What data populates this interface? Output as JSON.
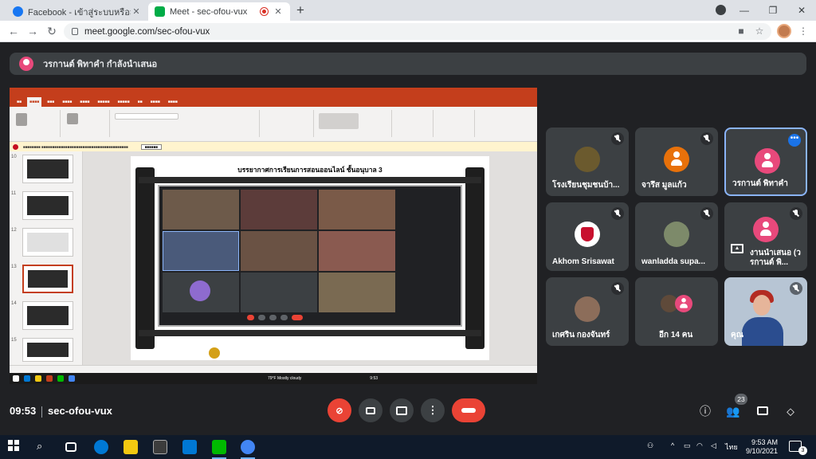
{
  "browser": {
    "tabs": [
      {
        "title": "Facebook - เข้าสู่ระบบหรือสมัครใช้งาน",
        "favicon_color": "#1877f2"
      },
      {
        "title": "Meet - sec-ofou-vux",
        "favicon_color": "#00ac47"
      }
    ],
    "url": "meet.google.com/sec-ofou-vux"
  },
  "banner": {
    "text": "วรกานต์ พิทาคำ กำลังนำเสนอ"
  },
  "presentation": {
    "slide_title": "บรรยากาศการเรียนการสอนออนไลน์ ชั้นอนุบาล 3",
    "thumb_numbers": [
      "10",
      "11",
      "12",
      "13",
      "14",
      "15"
    ],
    "taskbar_weather": "79°F  Mostly cloudy",
    "taskbar_time": "9:53"
  },
  "participants": [
    {
      "name": "โรงเรียนชุมชนบ้า...",
      "type": "photo",
      "color": "#6b5a2e"
    },
    {
      "name": "จารึส มูลแก้ว",
      "type": "avatar",
      "color": "#e8710a"
    },
    {
      "name": "วรกานต์ พิทาคำ",
      "type": "avatar",
      "color": "#e8497b"
    },
    {
      "name": "Akhom Srisawat",
      "type": "logo",
      "color": "#c8102e"
    },
    {
      "name": "wanladda supa...",
      "type": "photo",
      "color": "#7d8a6a"
    },
    {
      "name": "งานนำเสนอ (วรกานต์ พิ...",
      "type": "avatar",
      "color": "#e8497b"
    },
    {
      "name": "เกศริน กองจันทร์",
      "type": "photo",
      "color": "#8c6d5a"
    },
    {
      "name": "อีก 14 คน",
      "type": "group",
      "color": "#e8497b"
    },
    {
      "name": "คุณ",
      "type": "video",
      "color": "#b7c5d4"
    }
  ],
  "callbar": {
    "time": "09:53",
    "meeting_code": "sec-ofou-vux",
    "people_count": "23"
  },
  "taskbar": {
    "time": "9:53 AM",
    "date": "9/10/2021",
    "language": "ไทย",
    "notifications": "3"
  }
}
